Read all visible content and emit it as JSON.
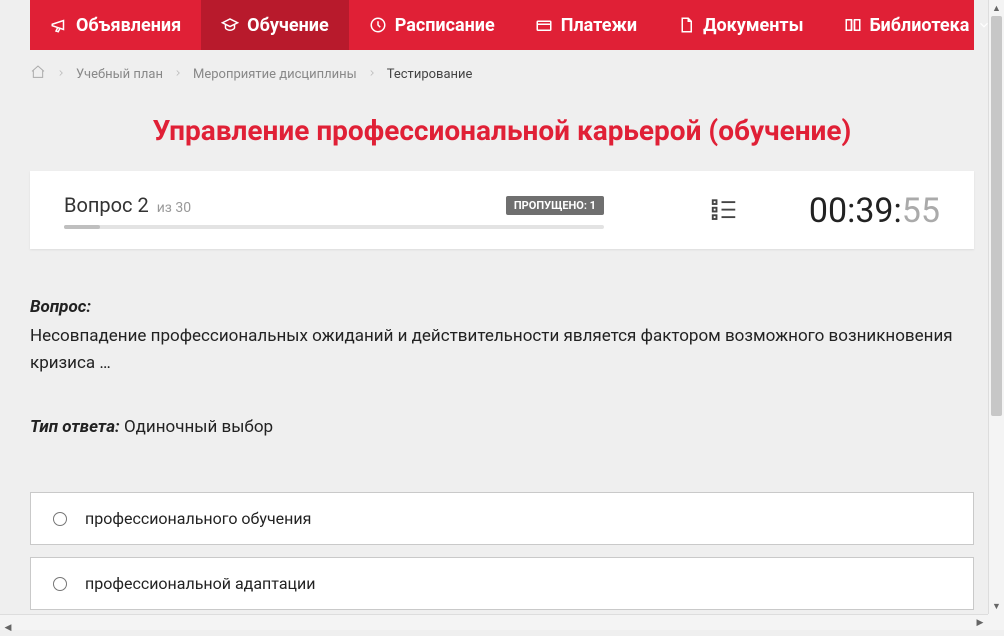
{
  "nav": {
    "items": [
      {
        "label": "Объявления",
        "icon": "megaphone"
      },
      {
        "label": "Обучение",
        "icon": "academic",
        "active": true
      },
      {
        "label": "Расписание",
        "icon": "clock"
      },
      {
        "label": "Платежи",
        "icon": "payment"
      },
      {
        "label": "Документы",
        "icon": "document"
      },
      {
        "label": "Библиотека",
        "icon": "library",
        "dropdown": true
      }
    ]
  },
  "breadcrumb": {
    "items": [
      "Учебный план",
      "Мероприятие дисциплины"
    ],
    "current": "Тестирование"
  },
  "page_title": "Управление профессиональной карьерой (обучение)",
  "status": {
    "question_label": "Вопрос 2",
    "total_label": "из 30",
    "skipped_label": "ПРОПУЩЕНО: 1",
    "progress_percent": 6.6,
    "timer_main": "00:39:",
    "timer_sec": "55"
  },
  "question": {
    "label": "Вопрос:",
    "text": "Несовпадение профессиональных ожиданий и действительности является фактором возможного возникновения кризиса …"
  },
  "answer_type": {
    "label": "Тип ответа:",
    "value": "Одиночный выбор"
  },
  "answers": [
    {
      "text": "профессионального обучения"
    },
    {
      "text": "профессиональной адаптации"
    }
  ]
}
